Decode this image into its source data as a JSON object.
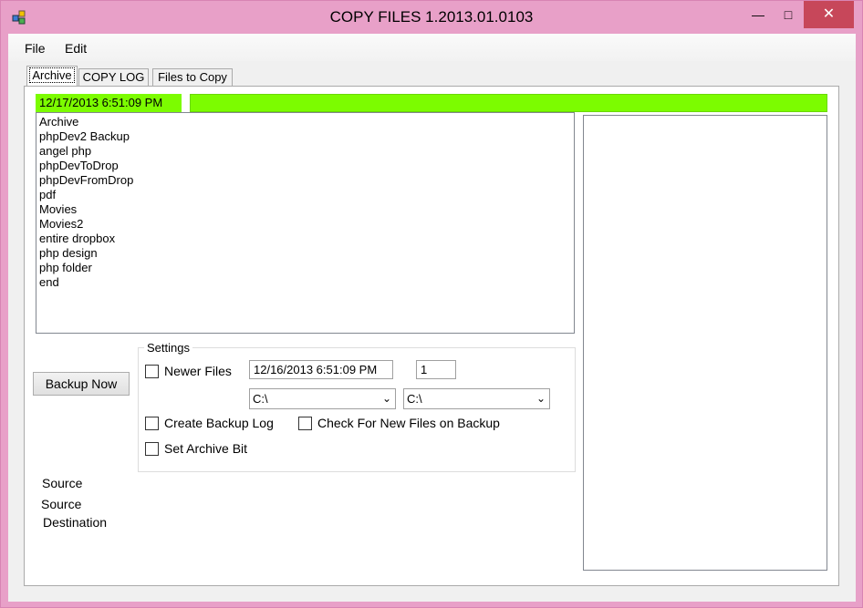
{
  "window": {
    "title": "COPY FILES 1.2013.01.0103",
    "min_glyph": "—",
    "max_glyph": "□",
    "close_glyph": "✕"
  },
  "menu": {
    "file": "File",
    "edit": "Edit"
  },
  "tabs": {
    "archive": "Archive",
    "copy_log": "COPY LOG",
    "files_to_copy": "Files to Copy"
  },
  "status": {
    "datetime": "12/17/2013 6:51:09 PM",
    "progress_fraction": 1.0,
    "accent_color": "#7cfc00"
  },
  "archive_list": [
    "Archive",
    "phpDev2 Backup",
    "angel php",
    "phpDevToDrop",
    "phpDevFromDrop",
    "pdf",
    "Movies",
    "Movies2",
    "entire dropbox",
    "php design",
    "php folder",
    "end"
  ],
  "backup_button": "Backup Now",
  "settings": {
    "legend": "Settings",
    "newer_files": "Newer Files",
    "newer_date": "12/16/2013 6:51:09 PM",
    "count": "1",
    "drive_left": "C:\\",
    "drive_right": "C:\\",
    "create_log": "Create Backup Log",
    "check_new": "Check For New Files on Backup",
    "set_archive_bit": "Set Archive Bit"
  },
  "labels": {
    "source1": "Source",
    "source2": "Source",
    "destination": "Destination"
  }
}
